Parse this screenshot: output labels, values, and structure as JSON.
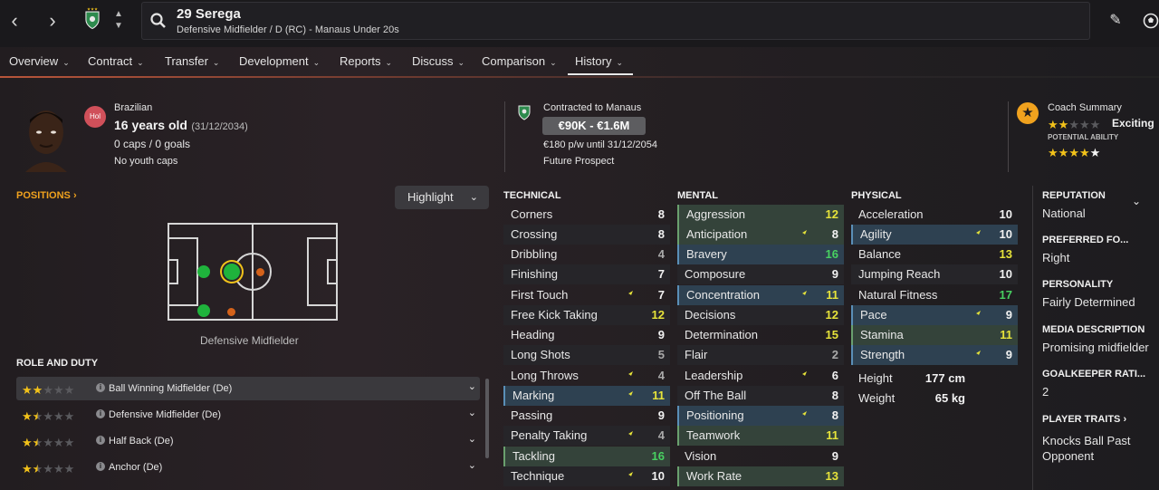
{
  "header": {
    "player_name": "29 Serega",
    "player_subtitle": "Defensive Midfielder / D (RC) - Manaus Under 20s"
  },
  "tabs": [
    "Overview",
    "Contract",
    "Transfer",
    "Development",
    "Reports",
    "Discuss",
    "Comparison",
    "History"
  ],
  "profile": {
    "nationality": "Brazilian",
    "badge": "Hol",
    "age": "16 years old",
    "dob": "(31/12/2034)",
    "caps": "0 caps / 0 goals",
    "youth_caps": "No youth caps"
  },
  "contract": {
    "club": "Contracted to Manaus",
    "value": "€90K - €1.6M",
    "wage": "€180 p/w until 31/12/2054",
    "status": "Future Prospect"
  },
  "coach": {
    "title": "Coach Summary",
    "current_stars": 2,
    "verdict": "Exciting",
    "potential_label": "POTENTIAL ABILITY",
    "potential_stars": 4
  },
  "positions": {
    "heading": "POSITIONS",
    "highlight_label": "Highlight",
    "pitch_caption": "Defensive Midfielder"
  },
  "roles": {
    "heading": "ROLE AND DUTY",
    "items": [
      {
        "name": "Ball Winning Midfielder (De)",
        "stars": 2
      },
      {
        "name": "Defensive Midfielder (De)",
        "stars": 1.5
      },
      {
        "name": "Half Back (De)",
        "stars": 1.5
      },
      {
        "name": "Anchor (De)",
        "stars": 1.5
      }
    ]
  },
  "attributes": {
    "technical_heading": "TECHNICAL",
    "mental_heading": "MENTAL",
    "physical_heading": "PHYSICAL",
    "technical": [
      {
        "n": "Corners",
        "v": "8"
      },
      {
        "n": "Crossing",
        "v": "8"
      },
      {
        "n": "Dribbling",
        "v": "4"
      },
      {
        "n": "Finishing",
        "v": "7"
      },
      {
        "n": "First Touch",
        "v": "7"
      },
      {
        "n": "Free Kick Taking",
        "v": "12"
      },
      {
        "n": "Heading",
        "v": "9"
      },
      {
        "n": "Long Shots",
        "v": "5"
      },
      {
        "n": "Long Throws",
        "v": "4"
      },
      {
        "n": "Marking",
        "v": "11"
      },
      {
        "n": "Passing",
        "v": "9"
      },
      {
        "n": "Penalty Taking",
        "v": "4"
      },
      {
        "n": "Tackling",
        "v": "16"
      },
      {
        "n": "Technique",
        "v": "10"
      }
    ],
    "mental": [
      {
        "n": "Aggression",
        "v": "12"
      },
      {
        "n": "Anticipation",
        "v": "8"
      },
      {
        "n": "Bravery",
        "v": "16"
      },
      {
        "n": "Composure",
        "v": "9"
      },
      {
        "n": "Concentration",
        "v": "11"
      },
      {
        "n": "Decisions",
        "v": "12"
      },
      {
        "n": "Determination",
        "v": "15"
      },
      {
        "n": "Flair",
        "v": "2"
      },
      {
        "n": "Leadership",
        "v": "6"
      },
      {
        "n": "Off The Ball",
        "v": "8"
      },
      {
        "n": "Positioning",
        "v": "8"
      },
      {
        "n": "Teamwork",
        "v": "11"
      },
      {
        "n": "Vision",
        "v": "9"
      },
      {
        "n": "Work Rate",
        "v": "13"
      }
    ],
    "physical": [
      {
        "n": "Acceleration",
        "v": "10"
      },
      {
        "n": "Agility",
        "v": "10"
      },
      {
        "n": "Balance",
        "v": "13"
      },
      {
        "n": "Jumping Reach",
        "v": "10"
      },
      {
        "n": "Natural Fitness",
        "v": "17"
      },
      {
        "n": "Pace",
        "v": "9"
      },
      {
        "n": "Stamina",
        "v": "11"
      },
      {
        "n": "Strength",
        "v": "9"
      }
    ],
    "height_label": "Height",
    "height": "177 cm",
    "weight_label": "Weight",
    "weight": "65 kg"
  },
  "side": {
    "reputation_h": "REPUTATION",
    "reputation": "National",
    "foot_h": "PREFERRED FO...",
    "foot": "Right",
    "personality_h": "PERSONALITY",
    "personality": "Fairly Determined",
    "media_h": "MEDIA DESCRIPTION",
    "media": "Promising midfielder",
    "gk_h": "GOALKEEPER RATI...",
    "gk": "2",
    "traits_h": "PLAYER TRAITS",
    "trait1": "Knocks Ball Past",
    "trait2": "Opponent"
  },
  "icons": [
    "back-icon",
    "forward-icon",
    "club-crest-icon",
    "search-icon",
    "edit-icon",
    "football-icon",
    "info-icon",
    "trending-icon"
  ]
}
